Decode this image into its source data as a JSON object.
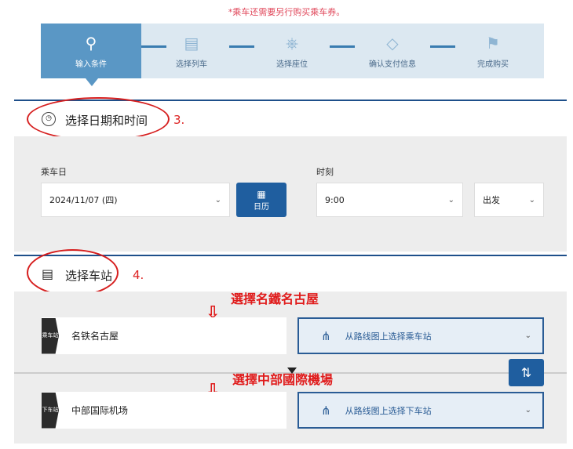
{
  "notice": "*乘车还需要另行购买乘车券。",
  "steps": [
    {
      "label": "输入条件",
      "icon": "search-icon",
      "active": true
    },
    {
      "label": "选择列车",
      "icon": "train-icon",
      "active": false
    },
    {
      "label": "选择座位",
      "icon": "seat-icon",
      "active": false
    },
    {
      "label": "确认支付信息",
      "icon": "card-icon",
      "active": false
    },
    {
      "label": "完成购买",
      "icon": "flag-icon",
      "active": false
    }
  ],
  "date_section": {
    "title": "选择日期和时间",
    "annotation": "3.",
    "date_label": "乘车日",
    "date_value": "2024/11/07 (四)",
    "calendar_label": "日历",
    "time_label": "时刻",
    "time_value": "9:00",
    "direction_value": "出发"
  },
  "station_section": {
    "title": "选择车站",
    "annotation": "4.",
    "from": {
      "tag": "乘车站",
      "value": "名铁名古屋",
      "route_label": "从路线图上选择乘车站",
      "annotation": "選擇名鐵名古屋"
    },
    "to": {
      "tag": "下车站",
      "value": "中部国际机场",
      "route_label": "从路线图上选择下车站",
      "annotation": "選擇中部國際機場"
    }
  },
  "colors": {
    "accent": "#1f5e9f",
    "annotation": "#e01b1b"
  }
}
